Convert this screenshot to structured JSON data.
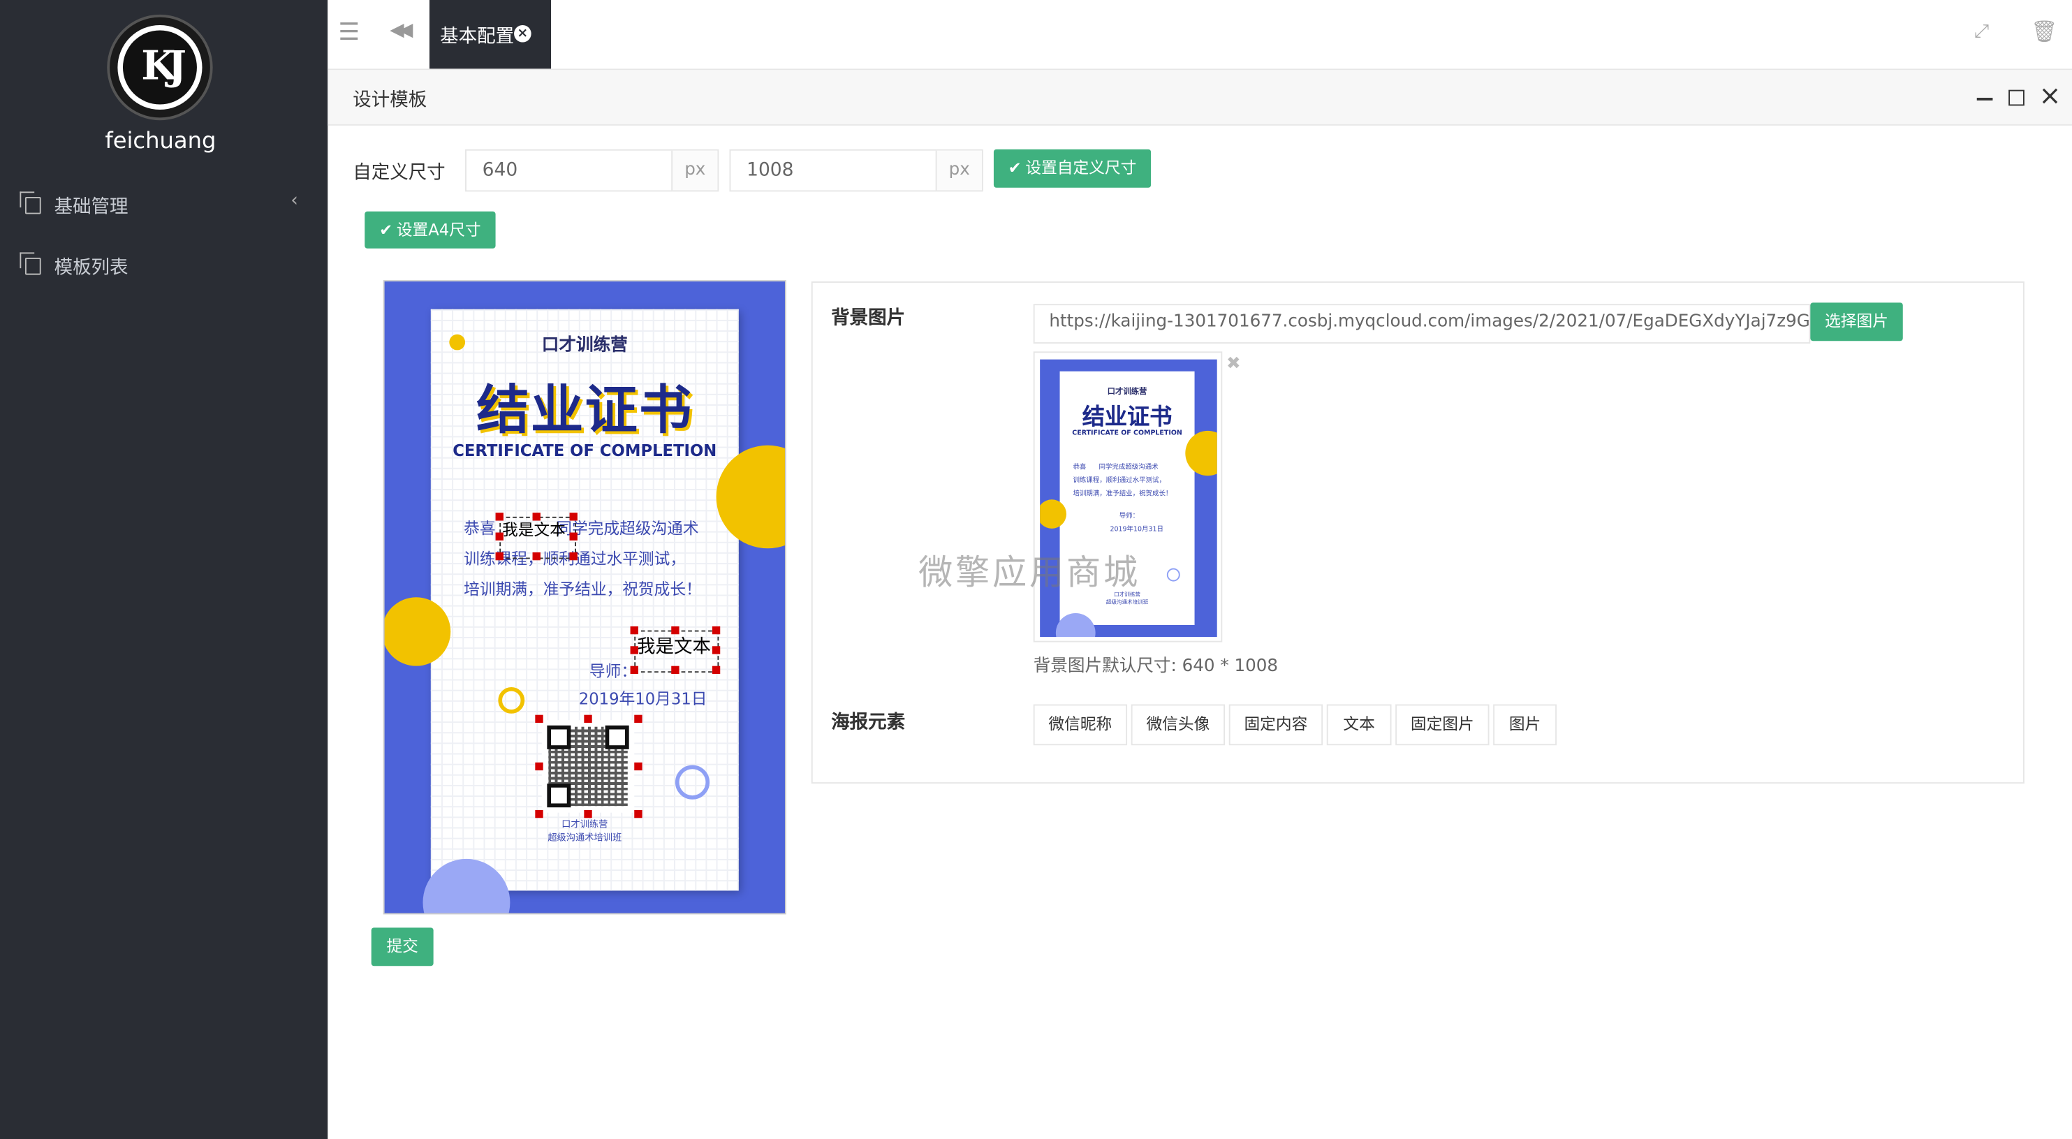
{
  "sidebar": {
    "logo_text": "KJ",
    "brand": "feichuang",
    "items": [
      {
        "label": "基础管理",
        "icon": "copy-icon",
        "chevron": "‹"
      },
      {
        "label": "模板列表",
        "icon": "copy-icon"
      }
    ]
  },
  "topbar": {
    "menu_icon": "hamburger-icon",
    "back_icon": "double-chevron-left-icon",
    "tab_label": "基本配置",
    "fullscreen_icon": "fullscreen-icon",
    "trash_icon": "trash-icon"
  },
  "panel": {
    "title": "设计模板"
  },
  "form": {
    "size_label": "自定义尺寸",
    "width_value": "640",
    "height_value": "1008",
    "unit": "px",
    "set_custom_label": "设置自定义尺寸",
    "set_a4_label": "设置A4尺寸",
    "submit_label": "提交"
  },
  "certificate": {
    "camp": "口才训练营",
    "title": "结业证书",
    "title_en": "CERTIFICATE  OF COMPLETION",
    "body_line1": "恭喜",
    "body_line1_rest": "同学完成超级沟通术",
    "body_line2": "训练课程，顺利通过水平测试，",
    "body_line3": "培训期满，准予结业，祝贺成长！",
    "teacher_prefix": "导师：",
    "date": "2019年10月31日",
    "footer_line1": "口才训练营",
    "footer_line2": "超级沟通术培训班",
    "overlay_text_1": "我是文本",
    "overlay_text_2": "我是文本"
  },
  "settings": {
    "bg_label": "背景图片",
    "bg_url": "https://kaijing-1301701677.cosbj.myqcloud.com/images/2/2021/07/EgaDEGXdyYJaj7z9G7FXDy",
    "choose_label": "选择图片",
    "remove_icon": "close-icon",
    "hint": "背景图片默认尺寸: 640 * 1008",
    "elements_label": "海报元素",
    "elements": [
      "微信昵称",
      "微信头像",
      "固定内容",
      "文本",
      "固定图片",
      "图片"
    ]
  },
  "watermark": "微擎应用商城",
  "colors": {
    "accent": "#3fb17f",
    "sidebar": "#2a2d34",
    "cert_blue": "#4d63d9",
    "cert_yellow": "#f2c200"
  }
}
